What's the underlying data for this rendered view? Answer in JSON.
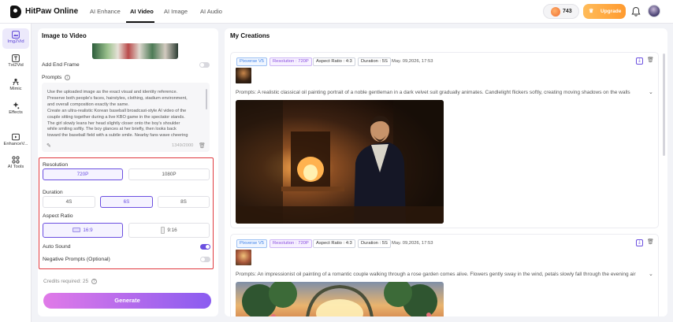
{
  "header": {
    "brand": "HitPaw Online",
    "nav": [
      "AI Enhance",
      "AI Video",
      "AI Image",
      "AI Audio"
    ],
    "active_nav": "AI Video",
    "credits": "743",
    "upgrade_label": "Upgrade"
  },
  "rail": {
    "items": [
      {
        "label": "Img2Vid",
        "icon": "image-video-icon"
      },
      {
        "label": "Txt2Vid",
        "icon": "text-video-icon"
      },
      {
        "label": "Mimic",
        "icon": "mimic-icon"
      },
      {
        "label": "Effects",
        "icon": "effects-icon"
      },
      {
        "label": "EnhanceV...",
        "icon": "enhance-video-icon"
      },
      {
        "label": "AI Tools",
        "icon": "ai-tools-icon"
      }
    ]
  },
  "panel": {
    "title": "Image to Video",
    "add_end_frame": "Add End Frame",
    "prompts_label": "Prompts",
    "prompt_text": "Use the uploaded image as the exact visual and identity reference.\nPreserve both people's faces, hairstyles, clothing, stadium environment,\nand overall composition exactly the same.\nCreate an ultra-realistic Korean baseball broadcast-style AI video of the\ncouple sitting together during a live KBO game in the spectator stands.\nThe girl slowly leans her head slightly closer onto the boy's shoulder\nwhile smiling softly. The boy glances at her briefly, then looks back\ntoward the baseball field with a subtle smile. Nearby fans wave cheering",
    "char_count": "1349/2000",
    "resolution_label": "Resolution",
    "resolutions": [
      "720P",
      "1080P"
    ],
    "selected_resolution": "720P",
    "duration_label": "Duration",
    "durations": [
      "4S",
      "6S",
      "8S"
    ],
    "selected_duration": "6S",
    "aspect_label": "Aspect Ratio",
    "aspects": [
      "16:9",
      "9:16"
    ],
    "selected_aspect": "16:9",
    "auto_sound_label": "Auto Sound",
    "auto_sound_on": true,
    "negative_label": "Negative Prompts (Optional)",
    "negative_on": false,
    "credits_required": "Credits required: 25",
    "generate_label": "Generate"
  },
  "creations": {
    "title": "My Creations",
    "cards": [
      {
        "model": "Pixverse V5",
        "resolution": "Resolution : 720P",
        "aspect": "Aspect Ratio : 4:3",
        "duration": "Duration : 5S",
        "date": "May. 09,2026, 17:53",
        "prompt": "Prompts: A realistic classical oil painting portrait of a noble gentleman in a dark velvet suit gradually animates. Candlelight flickers softly, creating moving shadows on the walls"
      },
      {
        "model": "Pixverse V5",
        "resolution": "Resolution : 720P",
        "aspect": "Aspect Ratio : 4:3",
        "duration": "Duration : 5S",
        "date": "May. 09,2026, 17:53",
        "prompt": "Prompts: An impressionist oil painting of a romantic couple walking through a rose garden comes alive. Flowers gently sway in the wind, petals slowly fall through the evening air"
      }
    ]
  },
  "colors": {
    "accent": "#6b4fe0",
    "highlight_border": "#e0393f",
    "upgrade": "#ff9a2f"
  }
}
